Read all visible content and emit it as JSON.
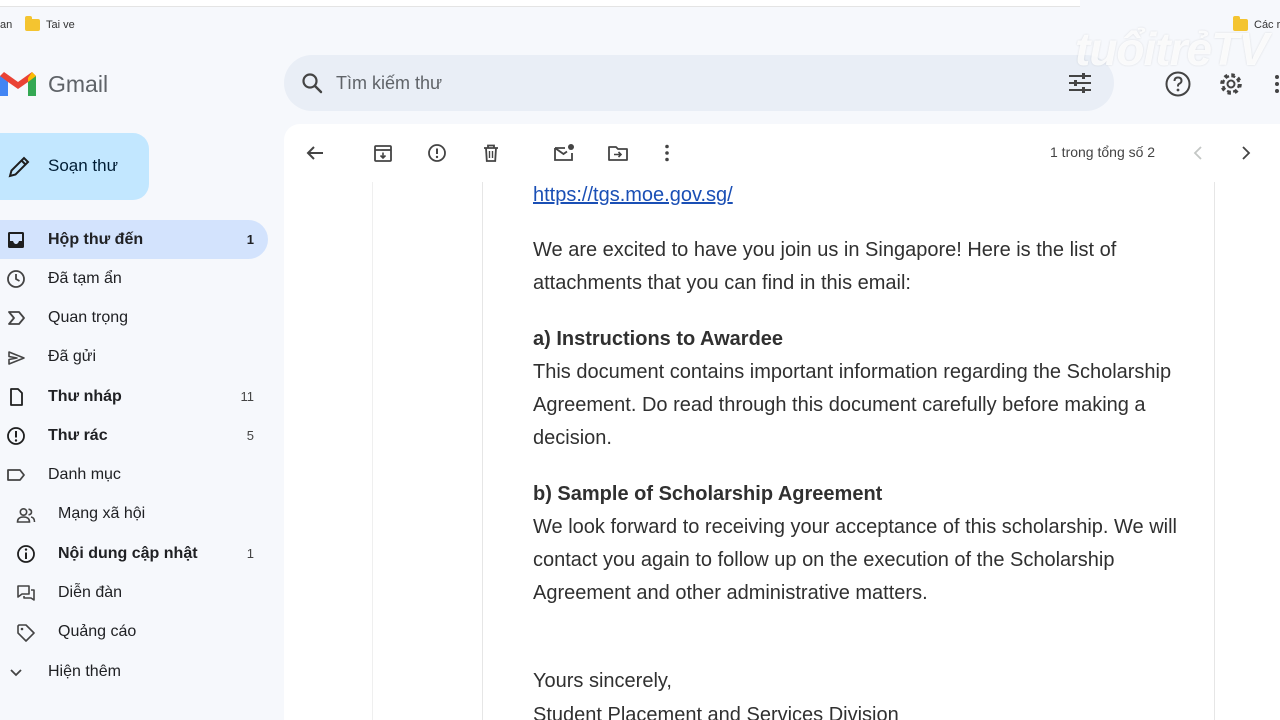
{
  "bookmarks": {
    "left_fragment": "an",
    "folder1": "Tai ve",
    "folder2": "Các r"
  },
  "watermark": "tuổitrẻTV",
  "gmail": {
    "logo_text": "Gmail",
    "search_placeholder": "Tìm kiếm thư"
  },
  "sidebar": {
    "compose": "Soạn thư",
    "items": [
      {
        "label": "Hộp thư đến",
        "count": "1"
      },
      {
        "label": "Đã tạm ẩn",
        "count": ""
      },
      {
        "label": "Quan trọng",
        "count": ""
      },
      {
        "label": "Đã gửi",
        "count": ""
      },
      {
        "label": "Thư nháp",
        "count": "11"
      },
      {
        "label": "Thư rác",
        "count": "5"
      },
      {
        "label": "Danh mục",
        "count": ""
      },
      {
        "label": "Mạng xã hội",
        "count": ""
      },
      {
        "label": "Nội dung cập nhật",
        "count": "1"
      },
      {
        "label": "Diễn đàn",
        "count": ""
      },
      {
        "label": "Quảng cáo",
        "count": ""
      },
      {
        "label": "Hiện thêm",
        "count": ""
      }
    ]
  },
  "toolbar": {
    "pager": "1 trong tổng số 2"
  },
  "email": {
    "link": "https://tgs.moe.gov.sg/",
    "intro": "We are excited to have you join us in Singapore! Here is the list of attachments that you can find in this email:",
    "heading_a": "a) Instructions to Awardee",
    "para_a": "This document contains important information regarding the Scholarship Agreement. Do read through this document carefully before making a decision.",
    "heading_b": "b) Sample of Scholarship Agreement",
    "para_b": "We look forward to receiving your acceptance of this scholarship. We will contact you again to follow up on the execution of the Scholarship Agreement and other administrative matters.",
    "closing": "Yours sincerely,",
    "signature": "Student Placement and Services Division"
  }
}
